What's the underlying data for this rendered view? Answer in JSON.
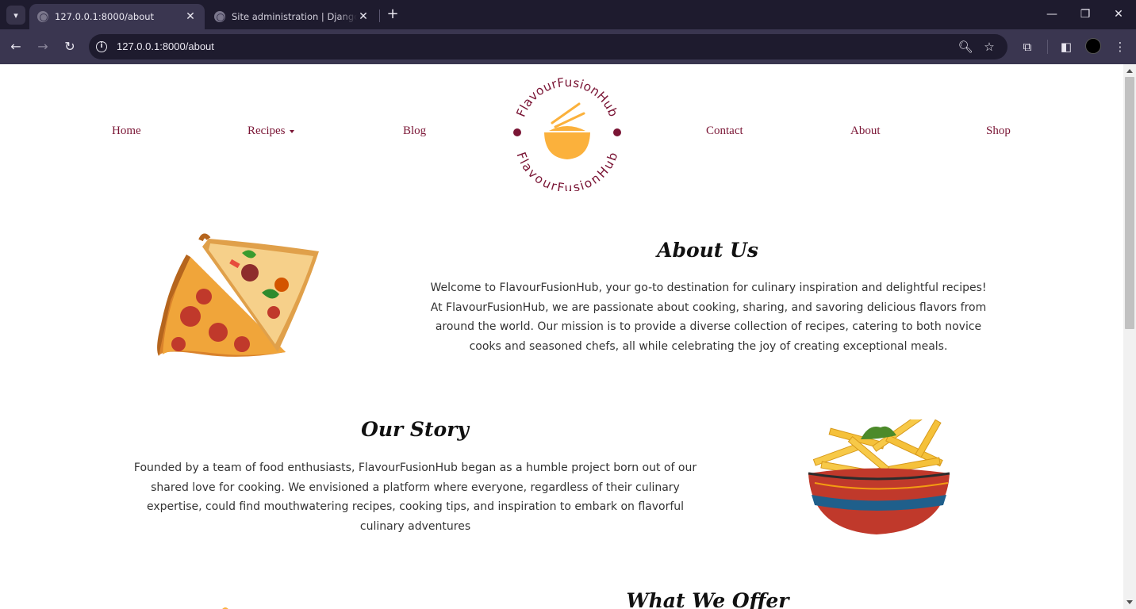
{
  "browser": {
    "tabs": [
      {
        "title": "127.0.0.1:8000/about",
        "active": true
      },
      {
        "title": "Site administration | Django site admin",
        "active": false
      }
    ],
    "new_tab_label": "+",
    "url": "127.0.0.1:8000/about",
    "window_controls": {
      "minimize": "—",
      "restore": "❐",
      "close": "✕"
    }
  },
  "site": {
    "nav": {
      "home": "Home",
      "recipes": "Recipes",
      "blog": "Blog",
      "contact": "Contact",
      "about": "About",
      "shop": "Shop"
    },
    "logo": {
      "top_text": "FlavourFusionHub",
      "bottom_text": "FlavourFusionHub",
      "brand_color": "#7a1535",
      "accent_color": "#fbb13c"
    },
    "about": {
      "heading": "About Us",
      "lines": [
        "Welcome to FlavourFusionHub, your go-to destination for culinary inspiration and delightful recipes!",
        "At FlavourFusionHub, we are passionate about cooking, sharing, and savoring delicious flavors from",
        "around the world. Our mission is to provide a diverse collection of recipes, catering to both novice",
        "cooks and seasoned chefs, all while celebrating the joy of creating exceptional meals."
      ]
    },
    "story": {
      "heading": "Our Story",
      "lines": [
        "Founded by a team of food enthusiasts, FlavourFusionHub began as a humble project born out of our",
        "shared love for cooking. We envisioned a platform where everyone, regardless of their culinary",
        "expertise, could find mouthwatering recipes, cooking tips, and inspiration to embark on flavorful",
        "culinary adventures"
      ]
    },
    "offer": {
      "heading": "What We Offer"
    },
    "images": {
      "pizza": "pizza-image",
      "fries": "fries-image"
    }
  }
}
